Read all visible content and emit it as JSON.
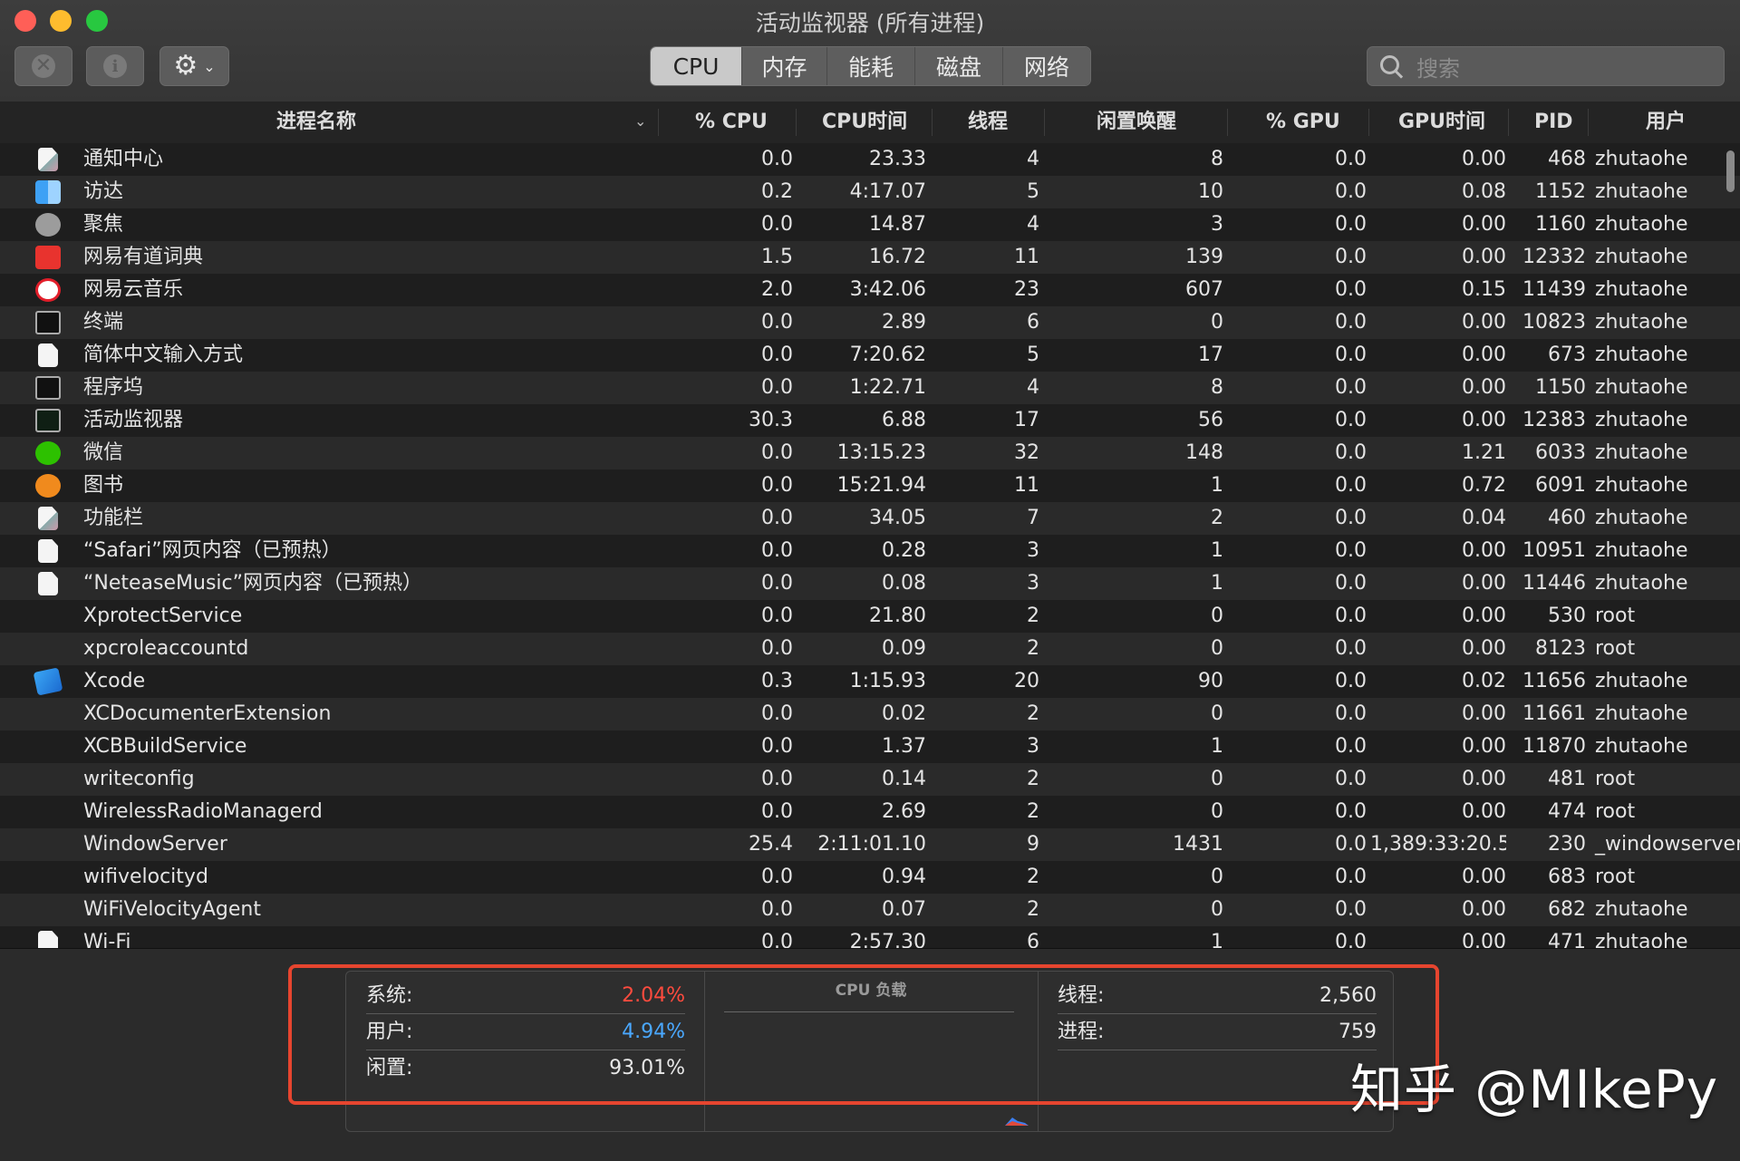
{
  "window": {
    "title": "活动监视器 (所有进程)"
  },
  "toolbar": {
    "stop_glyph": "✕",
    "info_glyph": "i",
    "gear_glyph": "⚙",
    "chevron_glyph": "⌄",
    "tabs": [
      {
        "label": "CPU",
        "active": true
      },
      {
        "label": "内存",
        "active": false
      },
      {
        "label": "能耗",
        "active": false
      },
      {
        "label": "磁盘",
        "active": false
      },
      {
        "label": "网络",
        "active": false
      }
    ],
    "search_placeholder": "搜索"
  },
  "columns": {
    "name": "进程名称",
    "cpu": "% CPU",
    "cpu_time": "CPU时间",
    "threads": "线程",
    "idle_wake": "闲置唤醒",
    "gpu": "% GPU",
    "gpu_time": "GPU时间",
    "pid": "PID",
    "user": "用户"
  },
  "rows": [
    {
      "icon": "notification-center-icon",
      "name": "通知中心",
      "cpu": "0.0",
      "time": "23.33",
      "threads": "4",
      "wake": "8",
      "gpu": "0.0",
      "gtime": "0.00",
      "pid": "468",
      "user": "zhutaohe"
    },
    {
      "icon": "finder-icon",
      "name": "访达",
      "cpu": "0.2",
      "time": "4:17.07",
      "threads": "5",
      "wake": "10",
      "gpu": "0.0",
      "gtime": "0.08",
      "pid": "1152",
      "user": "zhutaohe"
    },
    {
      "icon": "spotlight-icon",
      "name": "聚焦",
      "cpu": "0.0",
      "time": "14.87",
      "threads": "4",
      "wake": "3",
      "gpu": "0.0",
      "gtime": "0.00",
      "pid": "1160",
      "user": "zhutaohe"
    },
    {
      "icon": "youdao-dict-icon",
      "name": "网易有道词典",
      "cpu": "1.5",
      "time": "16.72",
      "threads": "11",
      "wake": "139",
      "gpu": "0.0",
      "gtime": "0.00",
      "pid": "12332",
      "user": "zhutaohe"
    },
    {
      "icon": "netease-music-icon",
      "name": "网易云音乐",
      "cpu": "2.0",
      "time": "3:42.06",
      "threads": "23",
      "wake": "607",
      "gpu": "0.0",
      "gtime": "0.15",
      "pid": "11439",
      "user": "zhutaohe"
    },
    {
      "icon": "terminal-icon",
      "name": "终端",
      "cpu": "0.0",
      "time": "2.89",
      "threads": "6",
      "wake": "0",
      "gpu": "0.0",
      "gtime": "0.00",
      "pid": "10823",
      "user": "zhutaohe"
    },
    {
      "icon": "document-icon",
      "name": "简体中文输入方式",
      "cpu": "0.0",
      "time": "7:20.62",
      "threads": "5",
      "wake": "17",
      "gpu": "0.0",
      "gtime": "0.00",
      "pid": "673",
      "user": "zhutaohe"
    },
    {
      "icon": "dock-icon",
      "name": "程序坞",
      "cpu": "0.0",
      "time": "1:22.71",
      "threads": "4",
      "wake": "8",
      "gpu": "0.0",
      "gtime": "0.00",
      "pid": "1150",
      "user": "zhutaohe"
    },
    {
      "icon": "activity-monitor-icon",
      "name": "活动监视器",
      "cpu": "30.3",
      "time": "6.88",
      "threads": "17",
      "wake": "56",
      "gpu": "0.0",
      "gtime": "0.00",
      "pid": "12383",
      "user": "zhutaohe"
    },
    {
      "icon": "wechat-icon",
      "name": "微信",
      "cpu": "0.0",
      "time": "13:15.23",
      "threads": "32",
      "wake": "148",
      "gpu": "0.0",
      "gtime": "1.21",
      "pid": "6033",
      "user": "zhutaohe"
    },
    {
      "icon": "books-icon",
      "name": "图书",
      "cpu": "0.0",
      "time": "15:21.94",
      "threads": "11",
      "wake": "1",
      "gpu": "0.0",
      "gtime": "0.72",
      "pid": "6091",
      "user": "zhutaohe"
    },
    {
      "icon": "control-strip-icon",
      "name": "功能栏",
      "cpu": "0.0",
      "time": "34.05",
      "threads": "7",
      "wake": "2",
      "gpu": "0.0",
      "gtime": "0.04",
      "pid": "460",
      "user": "zhutaohe"
    },
    {
      "icon": "document-icon",
      "name": "“Safari”网页内容（已预热）",
      "cpu": "0.0",
      "time": "0.28",
      "threads": "3",
      "wake": "1",
      "gpu": "0.0",
      "gtime": "0.00",
      "pid": "10951",
      "user": "zhutaohe"
    },
    {
      "icon": "document-icon",
      "name": "“NeteaseMusic”网页内容（已预热）",
      "cpu": "0.0",
      "time": "0.08",
      "threads": "3",
      "wake": "1",
      "gpu": "0.0",
      "gtime": "0.00",
      "pid": "11446",
      "user": "zhutaohe"
    },
    {
      "icon": "",
      "name": "XprotectService",
      "cpu": "0.0",
      "time": "21.80",
      "threads": "2",
      "wake": "0",
      "gpu": "0.0",
      "gtime": "0.00",
      "pid": "530",
      "user": "root"
    },
    {
      "icon": "",
      "name": "xpcroleaccountd",
      "cpu": "0.0",
      "time": "0.09",
      "threads": "2",
      "wake": "0",
      "gpu": "0.0",
      "gtime": "0.00",
      "pid": "8123",
      "user": "root"
    },
    {
      "icon": "xcode-icon",
      "name": "Xcode",
      "cpu": "0.3",
      "time": "1:15.93",
      "threads": "20",
      "wake": "90",
      "gpu": "0.0",
      "gtime": "0.02",
      "pid": "11656",
      "user": "zhutaohe"
    },
    {
      "icon": "",
      "name": "XCDocumenterExtension",
      "cpu": "0.0",
      "time": "0.02",
      "threads": "2",
      "wake": "0",
      "gpu": "0.0",
      "gtime": "0.00",
      "pid": "11661",
      "user": "zhutaohe"
    },
    {
      "icon": "",
      "name": "XCBBuildService",
      "cpu": "0.0",
      "time": "1.37",
      "threads": "3",
      "wake": "1",
      "gpu": "0.0",
      "gtime": "0.00",
      "pid": "11870",
      "user": "zhutaohe"
    },
    {
      "icon": "",
      "name": "writeconfig",
      "cpu": "0.0",
      "time": "0.14",
      "threads": "2",
      "wake": "0",
      "gpu": "0.0",
      "gtime": "0.00",
      "pid": "481",
      "user": "root"
    },
    {
      "icon": "",
      "name": "WirelessRadioManagerd",
      "cpu": "0.0",
      "time": "2.69",
      "threads": "2",
      "wake": "0",
      "gpu": "0.0",
      "gtime": "0.00",
      "pid": "474",
      "user": "root"
    },
    {
      "icon": "",
      "name": "WindowServer",
      "cpu": "25.4",
      "time": "2:11:01.10",
      "threads": "9",
      "wake": "1431",
      "gpu": "0.0",
      "gtime": "1,389:33:20.5",
      "pid": "230",
      "user": "_windowserver"
    },
    {
      "icon": "",
      "name": "wifivelocityd",
      "cpu": "0.0",
      "time": "0.94",
      "threads": "2",
      "wake": "0",
      "gpu": "0.0",
      "gtime": "0.00",
      "pid": "683",
      "user": "root"
    },
    {
      "icon": "",
      "name": "WiFiVelocityAgent",
      "cpu": "0.0",
      "time": "0.07",
      "threads": "2",
      "wake": "0",
      "gpu": "0.0",
      "gtime": "0.00",
      "pid": "682",
      "user": "zhutaohe"
    },
    {
      "icon": "document-icon",
      "name": "Wi-Fi",
      "cpu": "0.0",
      "time": "2:57.30",
      "threads": "6",
      "wake": "1",
      "gpu": "0.0",
      "gtime": "0.00",
      "pid": "471",
      "user": "zhutaohe"
    }
  ],
  "summary": {
    "system_label": "系统:",
    "system_value": "2.04%",
    "user_label": "用户:",
    "user_value": "4.94%",
    "idle_label": "闲置:",
    "idle_value": "93.01%",
    "cpu_load_title": "CPU 负载",
    "threads_label": "线程:",
    "threads_value": "2,560",
    "processes_label": "进程:",
    "processes_value": "759"
  },
  "watermark": "知乎 @MIkePy",
  "colors": {
    "system": "#ff4b3e",
    "user": "#4aa8ff",
    "highlight": "#e6452f"
  }
}
